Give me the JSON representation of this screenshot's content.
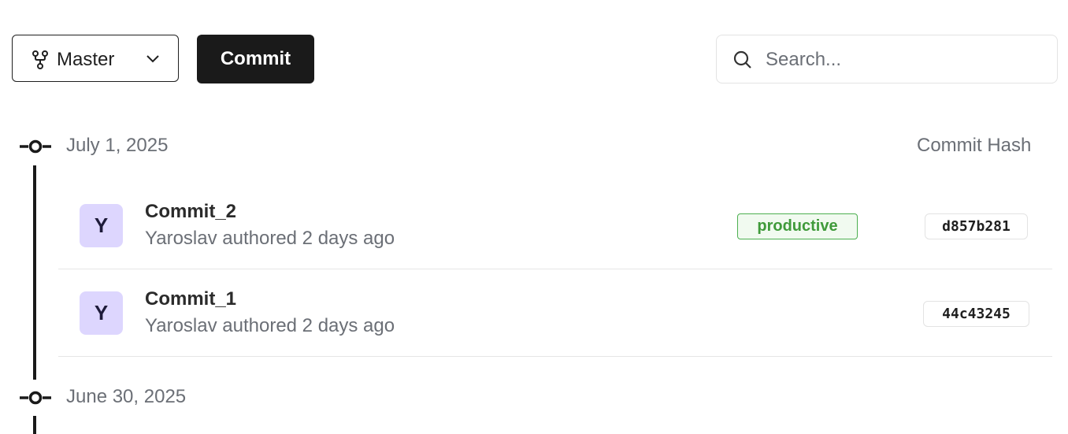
{
  "toolbar": {
    "branch_label": "Master",
    "commit_label": "Commit",
    "search_placeholder": "Search..."
  },
  "timeline": {
    "column_header": "Commit Hash",
    "groups": [
      {
        "date": "July 1, 2025",
        "commits": [
          {
            "avatar": "Y",
            "title": "Commit_2",
            "meta": "Yaroslav authored 2 days ago",
            "tag": "productive",
            "hash": "d857b281"
          },
          {
            "avatar": "Y",
            "title": "Commit_1",
            "meta": "Yaroslav authored 2 days ago",
            "tag": "",
            "hash": "44c43245"
          }
        ]
      },
      {
        "date": "June 30, 2025",
        "commits": []
      }
    ]
  },
  "colors": {
    "primary_button": "#1a1a1a",
    "avatar_bg": "#ddd6fe",
    "tag_green": "#4caf50"
  },
  "icons": {
    "branch": "git-branch-icon",
    "chevron": "chevron-down-icon",
    "search": "search-icon",
    "node": "git-commit-icon"
  }
}
